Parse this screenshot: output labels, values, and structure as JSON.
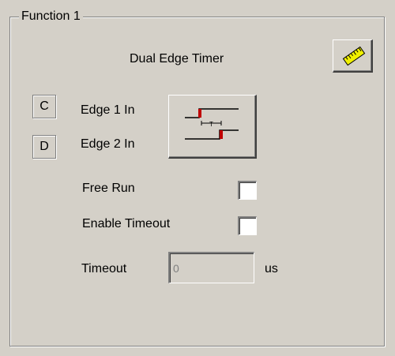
{
  "group": {
    "label": "Function 1"
  },
  "function": {
    "title": "Dual Edge Timer",
    "settings_icon": "ruler-icon"
  },
  "inputs": [
    {
      "channel": "C",
      "label": "Edge 1 In"
    },
    {
      "channel": "D",
      "label": "Edge 2 In"
    }
  ],
  "edge_button": {
    "icon": "dual-edge-timing-diagram-icon",
    "accent_color": "#c00000"
  },
  "options": {
    "free_run": {
      "label": "Free Run",
      "checked": false
    },
    "enable_timeout": {
      "label": "Enable Timeout",
      "checked": false
    }
  },
  "timeout": {
    "label": "Timeout",
    "value": "0",
    "unit": "us"
  },
  "colors": {
    "panel_bg": "#d4d0c8",
    "ruler_yellow": "#f0f000"
  }
}
